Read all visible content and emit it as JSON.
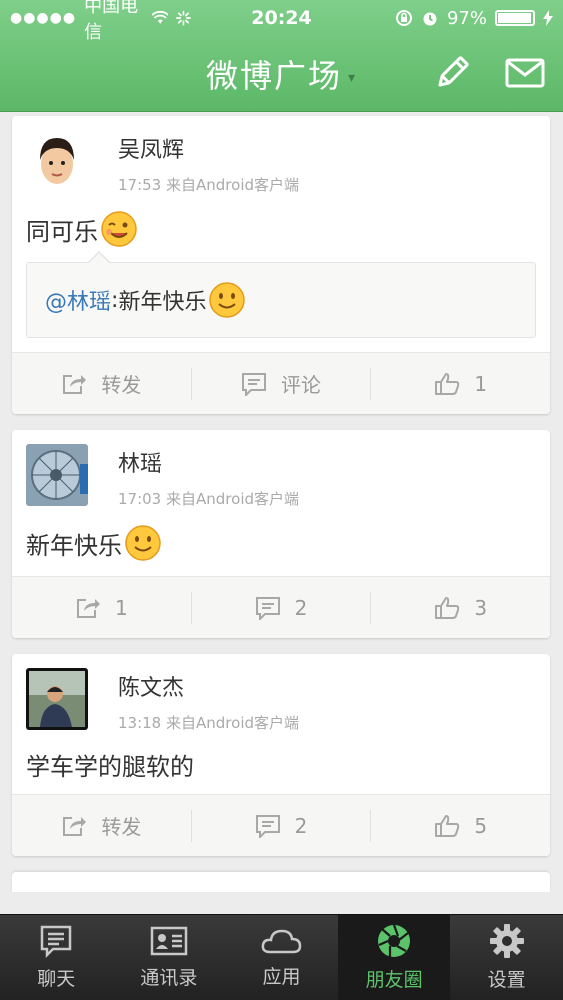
{
  "status": {
    "carrier": "中国电信",
    "time": "20:24",
    "battery": "97%",
    "battery_level": 0.97
  },
  "header": {
    "title": "微博广场",
    "title_caret": "▾"
  },
  "posts": [
    {
      "user": "吴凤辉",
      "time": "17:53",
      "source": "来自Android客户端",
      "text": "同可乐",
      "emoji": "wink-emoji",
      "quote": {
        "mention": "@林瑶",
        "separator": ": ",
        "text": "新年快乐",
        "emoji": "smile-emoji"
      },
      "repost": "转发",
      "comment": "评论",
      "like": "1"
    },
    {
      "user": "林瑶",
      "time": "17:03",
      "source": "来自Android客户端",
      "text": "新年快乐",
      "emoji": "smile-emoji",
      "repost": "1",
      "comment": "2",
      "like": "3"
    },
    {
      "user": "陈文杰",
      "time": "13:18",
      "source": "来自Android客户端",
      "text": "学车学的腿软的",
      "repost": "转发",
      "comment": "2",
      "like": "5"
    }
  ],
  "tabs": [
    {
      "label": "聊天",
      "icon": "chat-icon"
    },
    {
      "label": "通讯录",
      "icon": "contacts-icon"
    },
    {
      "label": "应用",
      "icon": "cloud-icon"
    },
    {
      "label": "朋友圈",
      "icon": "aperture-icon",
      "active": true
    },
    {
      "label": "设置",
      "icon": "gear-icon"
    }
  ],
  "colors": {
    "header_green": "#5cb867",
    "active_tab": "#5cc36b",
    "mention_blue": "#3a78b8"
  }
}
